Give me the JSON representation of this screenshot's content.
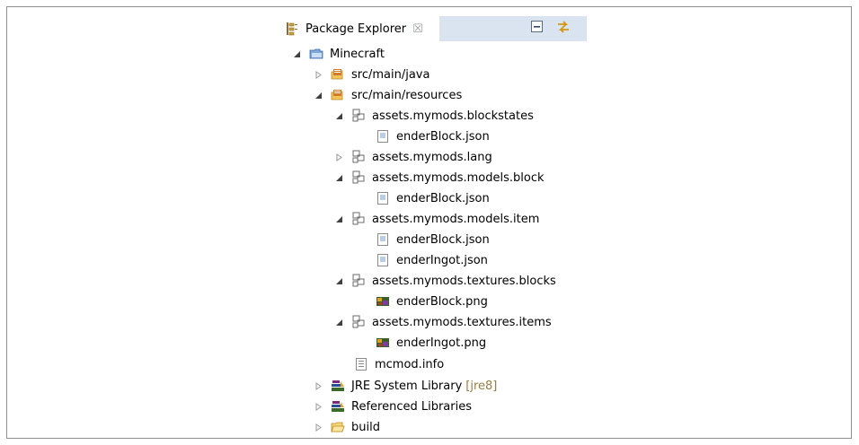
{
  "view": {
    "title": "Package Explorer",
    "close_glyph": "☒",
    "toolbar": [
      {
        "name": "collapse-all-icon"
      },
      {
        "name": "link-with-editor-icon"
      }
    ]
  },
  "tree": [
    {
      "label": "Minecraft",
      "icon": "project-folder-icon",
      "expanded": true
    },
    {
      "label": "src/main/java",
      "icon": "source-folder-icon",
      "expanded": false
    },
    {
      "label": "src/main/resources",
      "icon": "source-folder-icon",
      "expanded": true
    },
    {
      "label": "assets.mymods.blockstates",
      "icon": "package-icon",
      "expanded": true
    },
    {
      "label": "enderBlock.json",
      "icon": "file-icon"
    },
    {
      "label": "assets.mymods.lang",
      "icon": "package-icon",
      "expanded": false
    },
    {
      "label": "assets.mymods.models.block",
      "icon": "package-icon",
      "expanded": true
    },
    {
      "label": "enderBlock.json",
      "icon": "file-icon"
    },
    {
      "label": "assets.mymods.models.item",
      "icon": "package-icon",
      "expanded": true
    },
    {
      "label": "enderBlock.json",
      "icon": "file-icon"
    },
    {
      "label": "enderIngot.json",
      "icon": "file-icon"
    },
    {
      "label": "assets.mymods.textures.blocks",
      "icon": "package-icon",
      "expanded": true
    },
    {
      "label": "enderBlock.png",
      "icon": "image-file-icon"
    },
    {
      "label": "assets.mymods.textures.items",
      "icon": "package-icon",
      "expanded": true
    },
    {
      "label": "enderIngot.png",
      "icon": "image-file-icon"
    },
    {
      "label": "mcmod.info",
      "icon": "file-icon"
    },
    {
      "label": "JRE System Library",
      "decoration": "[jre8]",
      "icon": "library-icon",
      "expanded": false
    },
    {
      "label": "Referenced Libraries",
      "icon": "library-icon",
      "expanded": false
    },
    {
      "label": "build",
      "icon": "folder-icon",
      "expanded": false
    }
  ]
}
